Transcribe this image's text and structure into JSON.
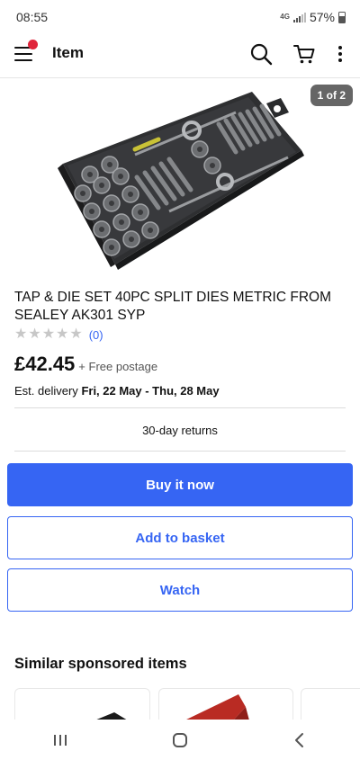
{
  "status_bar": {
    "time": "08:55",
    "network": "4G",
    "battery": "57%"
  },
  "header": {
    "title": "Item"
  },
  "gallery": {
    "counter": "1 of 2"
  },
  "product": {
    "title": "TAP & DIE SET 40PC SPLIT DIES METRIC FROM SEALEY AK301 SYP",
    "review_count": "(0)",
    "rating": 0,
    "price": "£42.45",
    "postage": "+ Free postage",
    "delivery_label": "Est. delivery",
    "delivery_dates": "Fri, 22 May - Thu, 28 May",
    "returns": "30-day returns"
  },
  "actions": {
    "buy_now": "Buy it now",
    "add_to_basket": "Add to basket",
    "watch": "Watch"
  },
  "similar": {
    "title": "Similar sponsored items"
  },
  "colors": {
    "accent": "#3665f3",
    "notification": "#e0243a"
  }
}
